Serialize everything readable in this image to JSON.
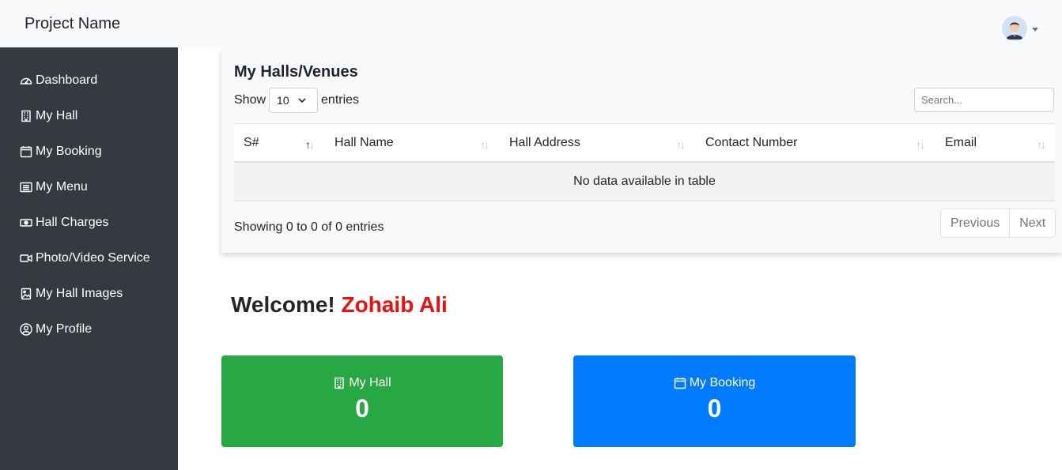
{
  "header": {
    "brand": "Project Name"
  },
  "sidebar": {
    "items": [
      {
        "label": "Dashboard",
        "icon": "speedometer-icon"
      },
      {
        "label": "My Hall",
        "icon": "building-icon"
      },
      {
        "label": "My Booking",
        "icon": "calendar-icon"
      },
      {
        "label": "My Menu",
        "icon": "list-icon"
      },
      {
        "label": "Hall Charges",
        "icon": "cash-icon"
      },
      {
        "label": "Photo/Video Service",
        "icon": "camera-video-icon"
      },
      {
        "label": "My Hall Images",
        "icon": "image-icon"
      },
      {
        "label": "My Profile",
        "icon": "person-circle-icon"
      }
    ]
  },
  "table_card": {
    "title": "My Halls/Venues",
    "show_label": "Show",
    "entries_label": "entries",
    "page_length": "10",
    "search_placeholder": "Search...",
    "columns": [
      "S#",
      "Hall Name",
      "Hall Address",
      "Contact Number",
      "Email"
    ],
    "empty_message": "No data available in table",
    "info": "Showing 0 to 0 of 0 entries",
    "previous_label": "Previous",
    "next_label": "Next"
  },
  "welcome": {
    "prefix": "Welcome!",
    "name": "Zohaib Ali"
  },
  "stats": [
    {
      "label": "My Hall",
      "value": "0",
      "icon": "building-icon",
      "color": "#28a745"
    },
    {
      "label": "My Booking",
      "value": "0",
      "icon": "calendar-icon",
      "color": "#007bff"
    }
  ],
  "colors": {
    "sidebar": "#343a40",
    "topbar": "#f8f9fa",
    "welcome_name": "#f10d0d"
  }
}
